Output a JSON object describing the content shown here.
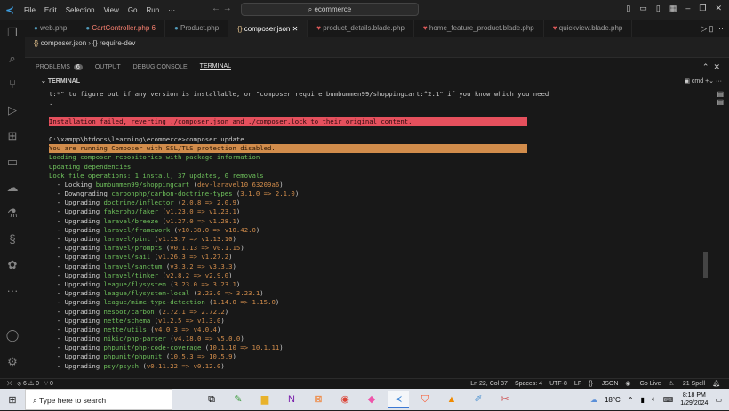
{
  "titlebar": {
    "menu": [
      "File",
      "Edit",
      "Selection",
      "View",
      "Go",
      "Run",
      "···"
    ],
    "search": "ecommerce"
  },
  "tabs": [
    {
      "label": "web.php",
      "icon": "php"
    },
    {
      "label": "CartController.php",
      "badge": "6",
      "icon": "php",
      "error": true
    },
    {
      "label": "Product.php",
      "icon": "php"
    },
    {
      "label": "composer.json",
      "icon": "json",
      "active": true
    },
    {
      "label": "product_details.blade.php",
      "icon": "blade"
    },
    {
      "label": "home_feature_product.blade.php",
      "icon": "blade"
    },
    {
      "label": "quickview.blade.php",
      "icon": "blade"
    }
  ],
  "breadcrumb": {
    "file": "composer.json",
    "symbol": "require-dev"
  },
  "panel": {
    "tabs": [
      "PROBLEMS",
      "OUTPUT",
      "DEBUG CONSOLE",
      "TERMINAL"
    ],
    "problems_count": "6",
    "terminal_header": "TERMINAL",
    "shell": "cmd"
  },
  "terminal": {
    "pre": [
      "t:*\" to figure out if any version is installable, or \"composer require bumbummen99/shoppingcart:^2.1\" if you know which you need",
      ".",
      ""
    ],
    "error": "Installation failed, reverting ./composer.json and ./composer.lock to their original content.",
    "prompt": "C:\\xampp\\htdocs\\learning\\ecommerce>composer update",
    "warning": "You are running Composer with SSL/TLS protection disabled.",
    "info": [
      "Loading composer repositories with package information",
      "Updating dependencies",
      "Lock file operations: 1 install, 37 updates, 0 removals"
    ],
    "ops": [
      [
        "Locking",
        "bumbummen99/shoppingcart",
        "dev-laravel10 63209a6"
      ],
      [
        "Downgrading",
        "carbonphp/carbon-doctrine-types",
        "3.1.0 => 2.1.0"
      ],
      [
        "Upgrading",
        "doctrine/inflector",
        "2.0.8 => 2.0.9"
      ],
      [
        "Upgrading",
        "fakerphp/faker",
        "v1.23.0 => v1.23.1"
      ],
      [
        "Upgrading",
        "laravel/breeze",
        "v1.27.0 => v1.28.1"
      ],
      [
        "Upgrading",
        "laravel/framework",
        "v10.38.0 => v10.42.0"
      ],
      [
        "Upgrading",
        "laravel/pint",
        "v1.13.7 => v1.13.10"
      ],
      [
        "Upgrading",
        "laravel/prompts",
        "v0.1.13 => v0.1.15"
      ],
      [
        "Upgrading",
        "laravel/sail",
        "v1.26.3 => v1.27.2"
      ],
      [
        "Upgrading",
        "laravel/sanctum",
        "v3.3.2 => v3.3.3"
      ],
      [
        "Upgrading",
        "laravel/tinker",
        "v2.8.2 => v2.9.0"
      ],
      [
        "Upgrading",
        "league/flysystem",
        "3.23.0 => 3.23.1"
      ],
      [
        "Upgrading",
        "league/flysystem-local",
        "3.23.0 => 3.23.1"
      ],
      [
        "Upgrading",
        "league/mime-type-detection",
        "1.14.0 => 1.15.0"
      ],
      [
        "Upgrading",
        "nesbot/carbon",
        "2.72.1 => 2.72.2"
      ],
      [
        "Upgrading",
        "nette/schema",
        "v1.2.5 => v1.3.0"
      ],
      [
        "Upgrading",
        "nette/utils",
        "v4.0.3 => v4.0.4"
      ],
      [
        "Upgrading",
        "nikic/php-parser",
        "v4.18.0 => v5.0.0"
      ],
      [
        "Upgrading",
        "phpunit/php-code-coverage",
        "10.1.10 => 10.1.11"
      ],
      [
        "Upgrading",
        "phpunit/phpunit",
        "10.5.3 => 10.5.9"
      ],
      [
        "Upgrading",
        "psy/psysh",
        "v0.11.22 => v0.12.0"
      ]
    ]
  },
  "status": {
    "errors": "6",
    "warnings": "0",
    "ports": "0",
    "position": "Ln 22, Col 37",
    "spaces": "Spaces: 4",
    "encoding": "UTF-8",
    "eol": "LF",
    "language": "JSON",
    "golive": "Go Live",
    "spell": "21 Spell"
  },
  "taskbar": {
    "search_placeholder": "Type here to search",
    "temperature": "18°C",
    "time": "8:18 PM",
    "date": "1/29/2024"
  },
  "colors": {
    "error": "#e5505d",
    "warning": "#d18c4b",
    "success": "#6fc25c",
    "accent": "#0078d4"
  }
}
